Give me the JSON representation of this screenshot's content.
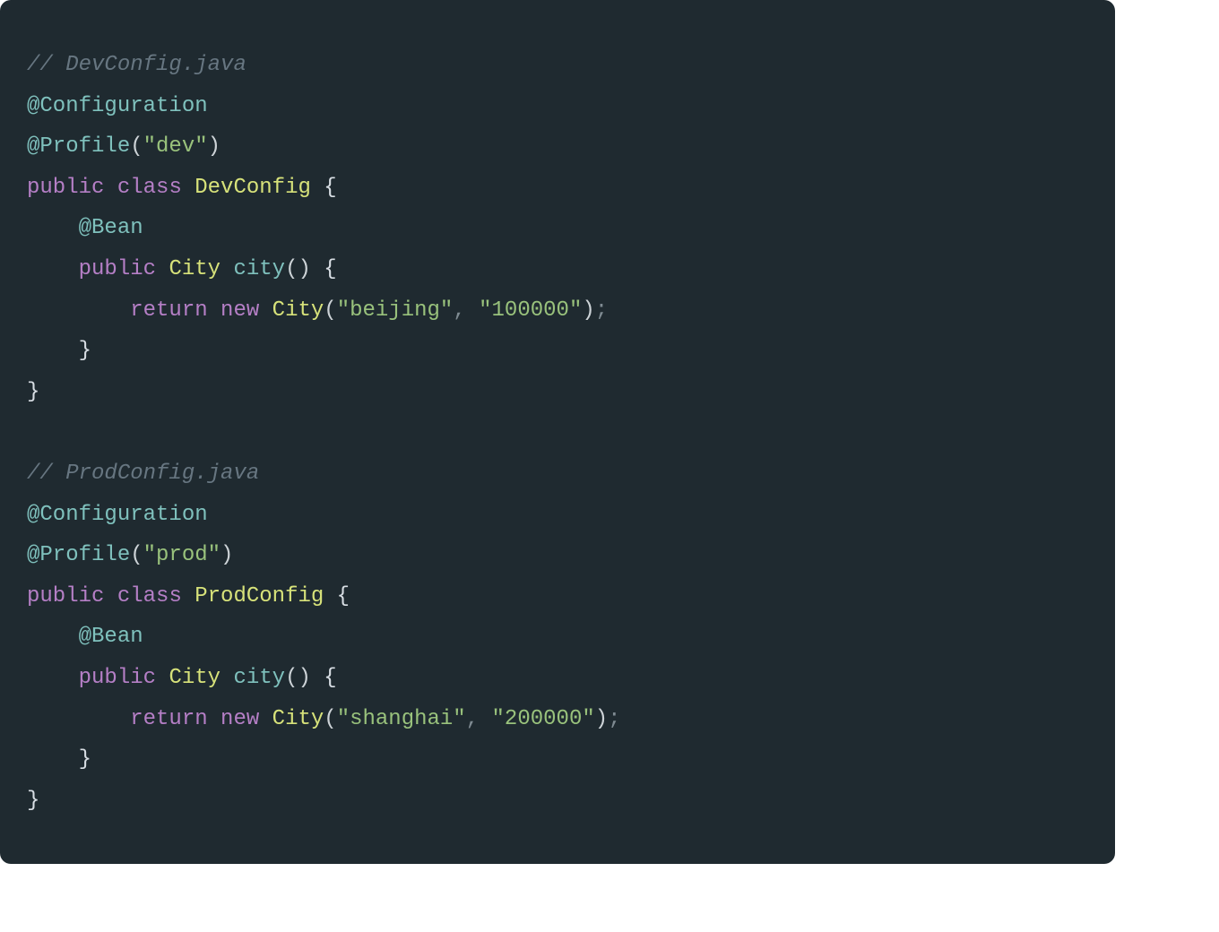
{
  "code": {
    "comment1": "// DevConfig.java",
    "anno_cfg1": "@Configuration",
    "anno_prof1_a": "@Profile",
    "paren_open": "(",
    "paren_close": ")",
    "dev_str": "\"dev\"",
    "kw_public": "public",
    "kw_class": "class",
    "type_devconfig": "DevConfig",
    "brace_open": " {",
    "brace_close": "}",
    "anno_bean": "@Bean",
    "type_city": "City",
    "method_city": "city",
    "empty_parens": "()",
    "kw_return": "return",
    "kw_new": "new",
    "beijing_str": "\"beijing\"",
    "zip1_str": "\"100000\"",
    "comma": ",",
    "semicolon": ";",
    "indent1": "    ",
    "indent2": "        ",
    "space": " ",
    "comment2": "// ProdConfig.java",
    "anno_cfg2": "@Configuration",
    "anno_prof2_a": "@Profile",
    "prod_str": "\"prod\"",
    "type_prodconfig": "ProdConfig",
    "shanghai_str": "\"shanghai\"",
    "zip2_str": "\"200000\""
  }
}
